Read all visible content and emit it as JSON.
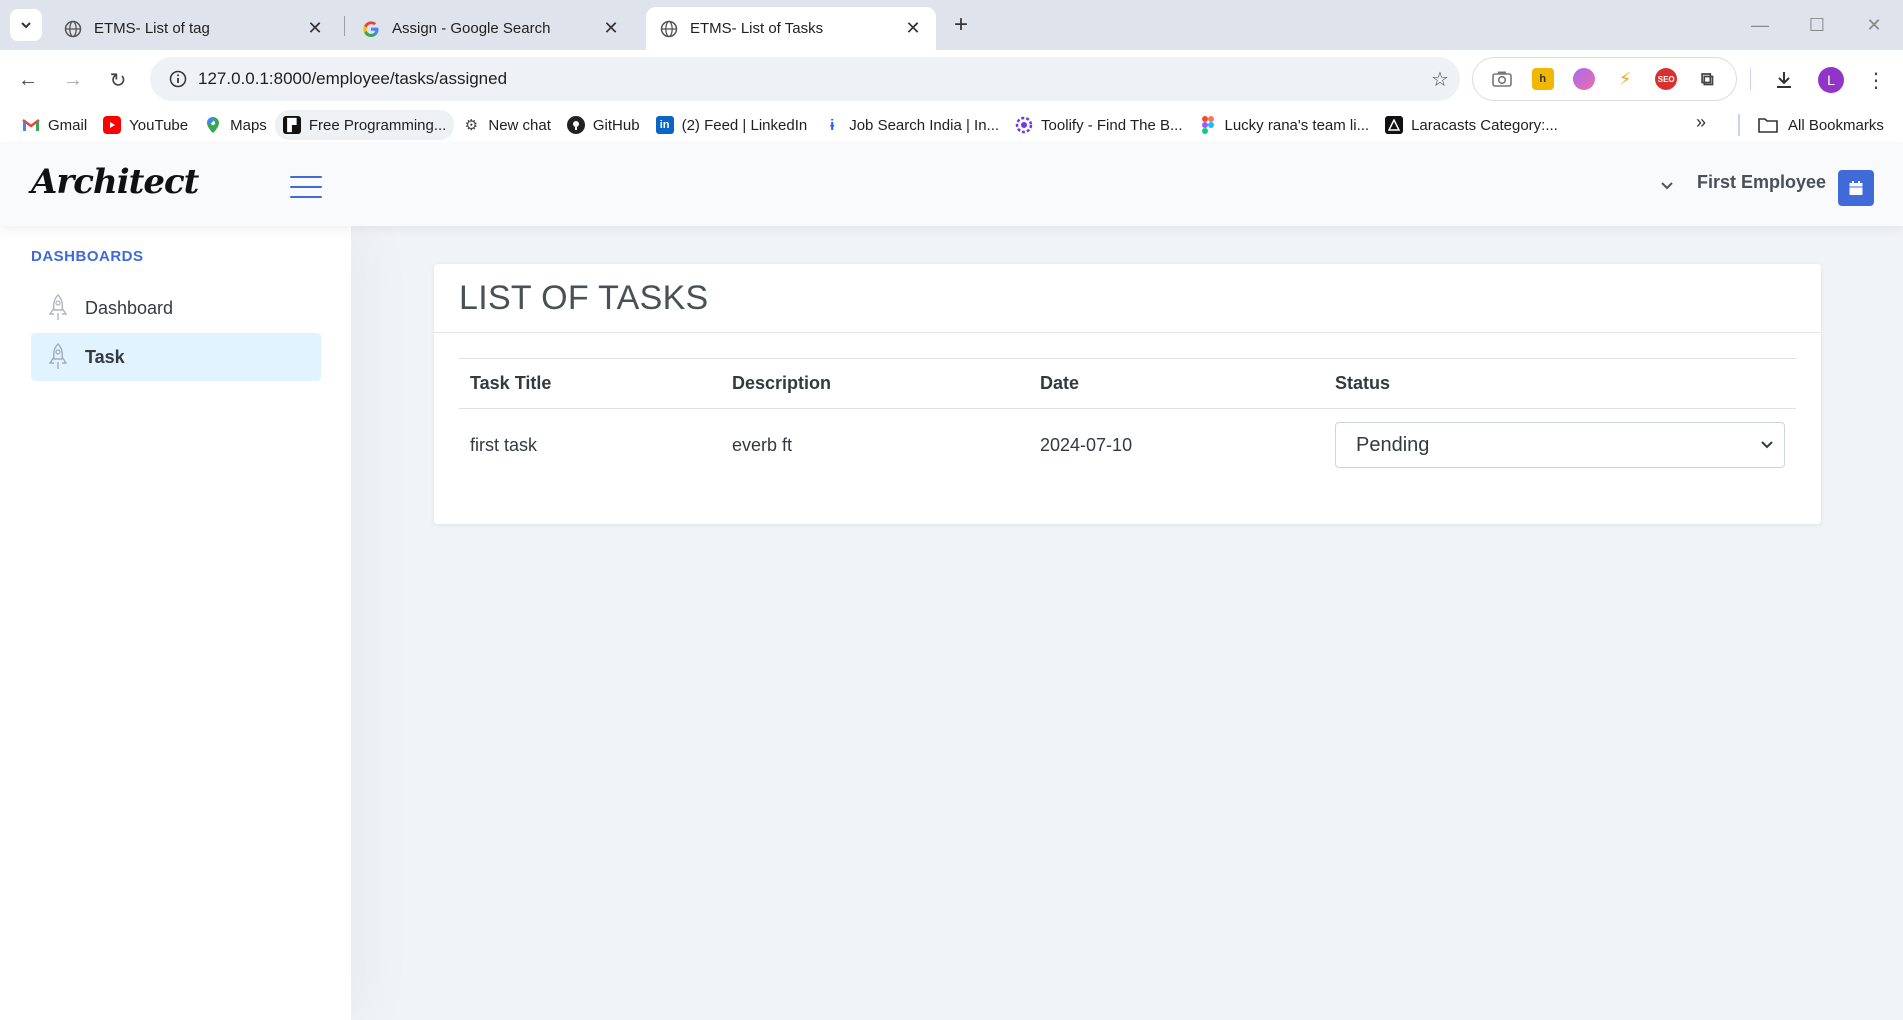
{
  "browser": {
    "tabs": [
      {
        "title": "ETMS- List of tag",
        "active": false
      },
      {
        "title": "Assign - Google Search",
        "active": false
      },
      {
        "title": "ETMS- List of Tasks",
        "active": true
      }
    ],
    "url": "127.0.0.1:8000/employee/tasks/assigned",
    "profile_initial": "L",
    "bookmarks": [
      {
        "label": "Gmail",
        "icon": "gmail-icon"
      },
      {
        "label": "YouTube",
        "icon": "youtube-icon"
      },
      {
        "label": "Maps",
        "icon": "maps-icon"
      },
      {
        "label": "Free Programming...",
        "icon": "bookmark-site-icon"
      },
      {
        "label": "New chat",
        "icon": "chatgpt-icon"
      },
      {
        "label": "GitHub",
        "icon": "github-icon"
      },
      {
        "label": "(2) Feed | LinkedIn",
        "icon": "linkedin-icon"
      },
      {
        "label": "Job Search India | In...",
        "icon": "indeed-icon"
      },
      {
        "label": "Toolify - Find The B...",
        "icon": "toolify-icon"
      },
      {
        "label": "Lucky rana's team li...",
        "icon": "figma-icon"
      },
      {
        "label": "Laracasts Category:...",
        "icon": "laracasts-icon"
      }
    ],
    "all_bookmarks_label": "All Bookmarks"
  },
  "app": {
    "logo": "Architect",
    "user_name": "First Employee"
  },
  "sidebar": {
    "heading": "DASHBOARDS",
    "items": [
      {
        "label": "Dashboard",
        "active": false
      },
      {
        "label": "Task",
        "active": true
      }
    ]
  },
  "main": {
    "title": "LIST OF TASKS",
    "columns": [
      "Task Title",
      "Description",
      "Date",
      "Status"
    ],
    "rows": [
      {
        "title": "first task",
        "description": "everb ft",
        "date": "2024-07-10",
        "status": "Pending"
      }
    ]
  },
  "colors": {
    "accent": "#3f6ad8",
    "active_item_bg": "#e0f3ff",
    "page_bg": "#f1f4f6"
  }
}
